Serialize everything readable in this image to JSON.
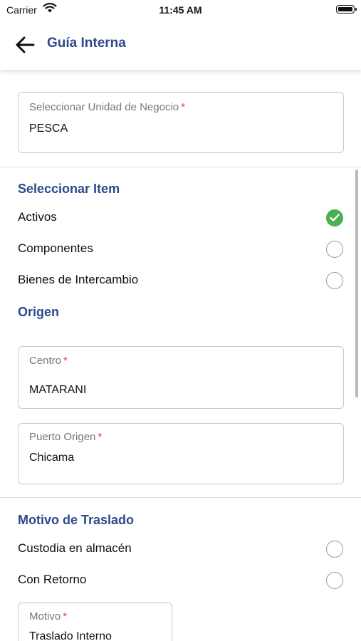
{
  "status_bar": {
    "carrier": "Carrier",
    "time": "11:45 AM"
  },
  "header": {
    "title": "Guía Interna"
  },
  "business_unit": {
    "label": "Seleccionar Unidad de Negocio",
    "required_mark": "*",
    "value": "PESCA"
  },
  "item_section": {
    "title": "Seleccionar Item",
    "options": [
      {
        "label": "Activos",
        "selected": true
      },
      {
        "label": "Componentes",
        "selected": false
      },
      {
        "label": "Bienes de Intercambio",
        "selected": false
      }
    ]
  },
  "origin_section": {
    "title": "Origen",
    "centro": {
      "label": "Centro",
      "required_mark": "*",
      "value": "MATARANI"
    },
    "puerto": {
      "label": "Puerto Origen",
      "required_mark": "*",
      "value": "Chicama"
    }
  },
  "transfer_section": {
    "title": "Motivo de Traslado",
    "options": [
      {
        "label": "Custodia en almacén",
        "selected": false
      },
      {
        "label": "Con Retorno",
        "selected": false
      }
    ],
    "motivo": {
      "label": "Motivo",
      "required_mark": "*",
      "value": "Traslado Interno"
    }
  },
  "colors": {
    "accent": "#2b4a8b",
    "selected": "#4ab04f",
    "required": "#e0413b"
  }
}
